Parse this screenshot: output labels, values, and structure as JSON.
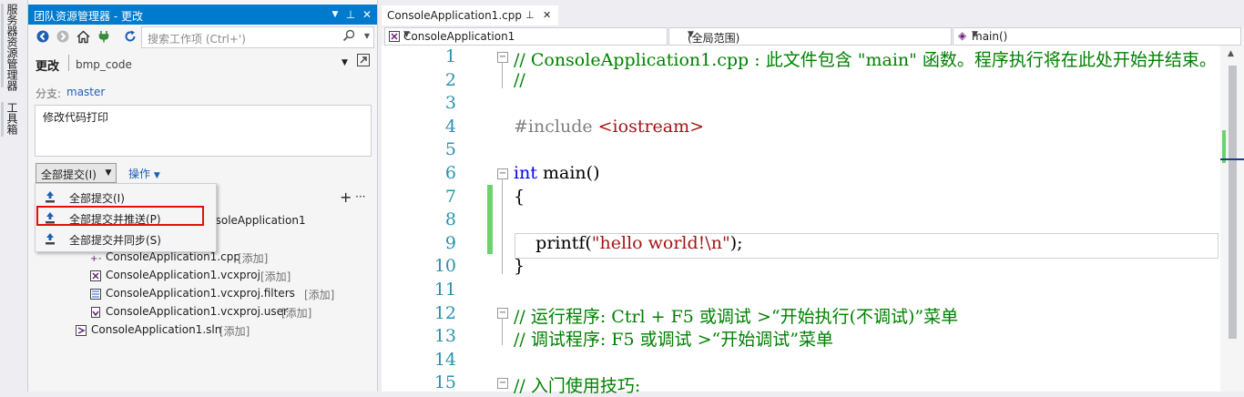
{
  "side_tabs": [
    "服务器资源管理器",
    "工具箱"
  ],
  "team_explorer": {
    "title": "团队资源管理器 - 更改",
    "search_placeholder": "搜索工作项 (Ctrl+')",
    "page_title": "更改",
    "repo": "bmp_code",
    "branch_label": "分支:",
    "branch": "master",
    "commit_message": "修改代码打印",
    "commit_button": "全部提交(I)",
    "actions": "操作",
    "dropdown": [
      {
        "label": "全部提交(I)"
      },
      {
        "label": "全部提交并推送(P)"
      },
      {
        "label": "全部提交并同步(S)"
      }
    ],
    "partial_folder": "nsoleApplication1",
    "files": [
      {
        "name": "ConsoleApplication1.cpp",
        "tag": "[添加]"
      },
      {
        "name": "ConsoleApplication1.vcxproj",
        "tag": "[添加]"
      },
      {
        "name": "ConsoleApplication1.vcxproj.filters",
        "tag": "[添加]"
      },
      {
        "name": "ConsoleApplication1.vcxproj.user",
        "tag": "[添加]"
      },
      {
        "name": "ConsoleApplication1.sln",
        "tag": "[添加]"
      }
    ]
  },
  "editor": {
    "tab": "ConsoleApplication1.cpp",
    "nav": [
      "ConsoleApplication1",
      "(全局范围)",
      "main()"
    ],
    "lines": [
      {
        "n": "1",
        "parts": [
          [
            "cm",
            "// ConsoleApplication1.cpp : 此文件包含 \"main\" 函数。程序执行将在此处开始并结束。"
          ]
        ]
      },
      {
        "n": "2",
        "parts": [
          [
            "cm",
            "//"
          ]
        ]
      },
      {
        "n": "3",
        "parts": []
      },
      {
        "n": "4",
        "parts": [
          [
            "pp",
            "#include "
          ],
          [
            "st",
            "<iostream>"
          ]
        ]
      },
      {
        "n": "5",
        "parts": []
      },
      {
        "n": "6",
        "parts": [
          [
            "kw",
            "int"
          ],
          [
            "",
            " main()"
          ]
        ]
      },
      {
        "n": "7",
        "parts": [
          [
            "",
            "{"
          ]
        ]
      },
      {
        "n": "8",
        "parts": []
      },
      {
        "n": "9",
        "parts": [
          [
            "",
            "    printf("
          ],
          [
            "st",
            "\"hello world!\\n\""
          ],
          [
            "",
            ");"
          ]
        ]
      },
      {
        "n": "10",
        "parts": [
          [
            "",
            "}"
          ]
        ]
      },
      {
        "n": "11",
        "parts": []
      },
      {
        "n": "12",
        "parts": [
          [
            "cm",
            "// 运行程序: Ctrl + F5 或调试 >“开始执行(不调试)”菜单"
          ]
        ]
      },
      {
        "n": "13",
        "parts": [
          [
            "cm",
            "// 调试程序: F5 或调试 >“开始调试”菜单"
          ]
        ]
      },
      {
        "n": "14",
        "parts": []
      },
      {
        "n": "15",
        "parts": [
          [
            "cm",
            "// 入门使用技巧:"
          ]
        ]
      }
    ]
  },
  "colors": {
    "accent": "#007acc",
    "highlight_border": "#e01010",
    "change_bar": "#6cd36c"
  }
}
